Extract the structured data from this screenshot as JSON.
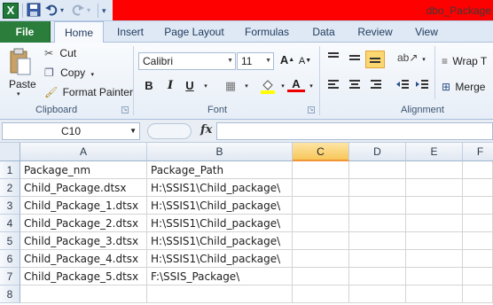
{
  "titlebar": {
    "app_icon": "X",
    "title": "dbo_Package"
  },
  "tabs": [
    "File",
    "Home",
    "Insert",
    "Page Layout",
    "Formulas",
    "Data",
    "Review",
    "View"
  ],
  "ribbon": {
    "clipboard": {
      "paste": "Paste",
      "cut": "Cut",
      "copy": "Copy",
      "format_painter": "Format Painter",
      "label": "Clipboard"
    },
    "font": {
      "font_name": "Calibri",
      "font_size": "11",
      "bold": "B",
      "italic": "I",
      "underline": "U",
      "label": "Font"
    },
    "alignment": {
      "wrap_text": "Wrap T",
      "merge": "Merge",
      "label": "Alignment"
    }
  },
  "formula_bar": {
    "name_box": "C10",
    "fx": "fx",
    "value": ""
  },
  "sheet": {
    "columns": [
      "A",
      "B",
      "C",
      "D",
      "E",
      "F"
    ],
    "selected_column": "C",
    "rows": [
      {
        "num": "1",
        "A": "Package_nm",
        "B": "Package_Path"
      },
      {
        "num": "2",
        "A": "Child_Package.dtsx",
        "B": "H:\\SSIS1\\Child_package\\"
      },
      {
        "num": "3",
        "A": "Child_Package_1.dtsx",
        "B": "H:\\SSIS1\\Child_package\\"
      },
      {
        "num": "4",
        "A": "Child_Package_2.dtsx",
        "B": "H:\\SSIS1\\Child_package\\"
      },
      {
        "num": "5",
        "A": "Child_Package_3.dtsx",
        "B": "H:\\SSIS1\\Child_package\\"
      },
      {
        "num": "6",
        "A": "Child_Package_4.dtsx",
        "B": "H:\\SSIS1\\Child_package\\"
      },
      {
        "num": "7",
        "A": "Child_Package_5.dtsx",
        "B": "F:\\SSIS_Package\\"
      },
      {
        "num": "8",
        "A": "",
        "B": ""
      }
    ]
  }
}
